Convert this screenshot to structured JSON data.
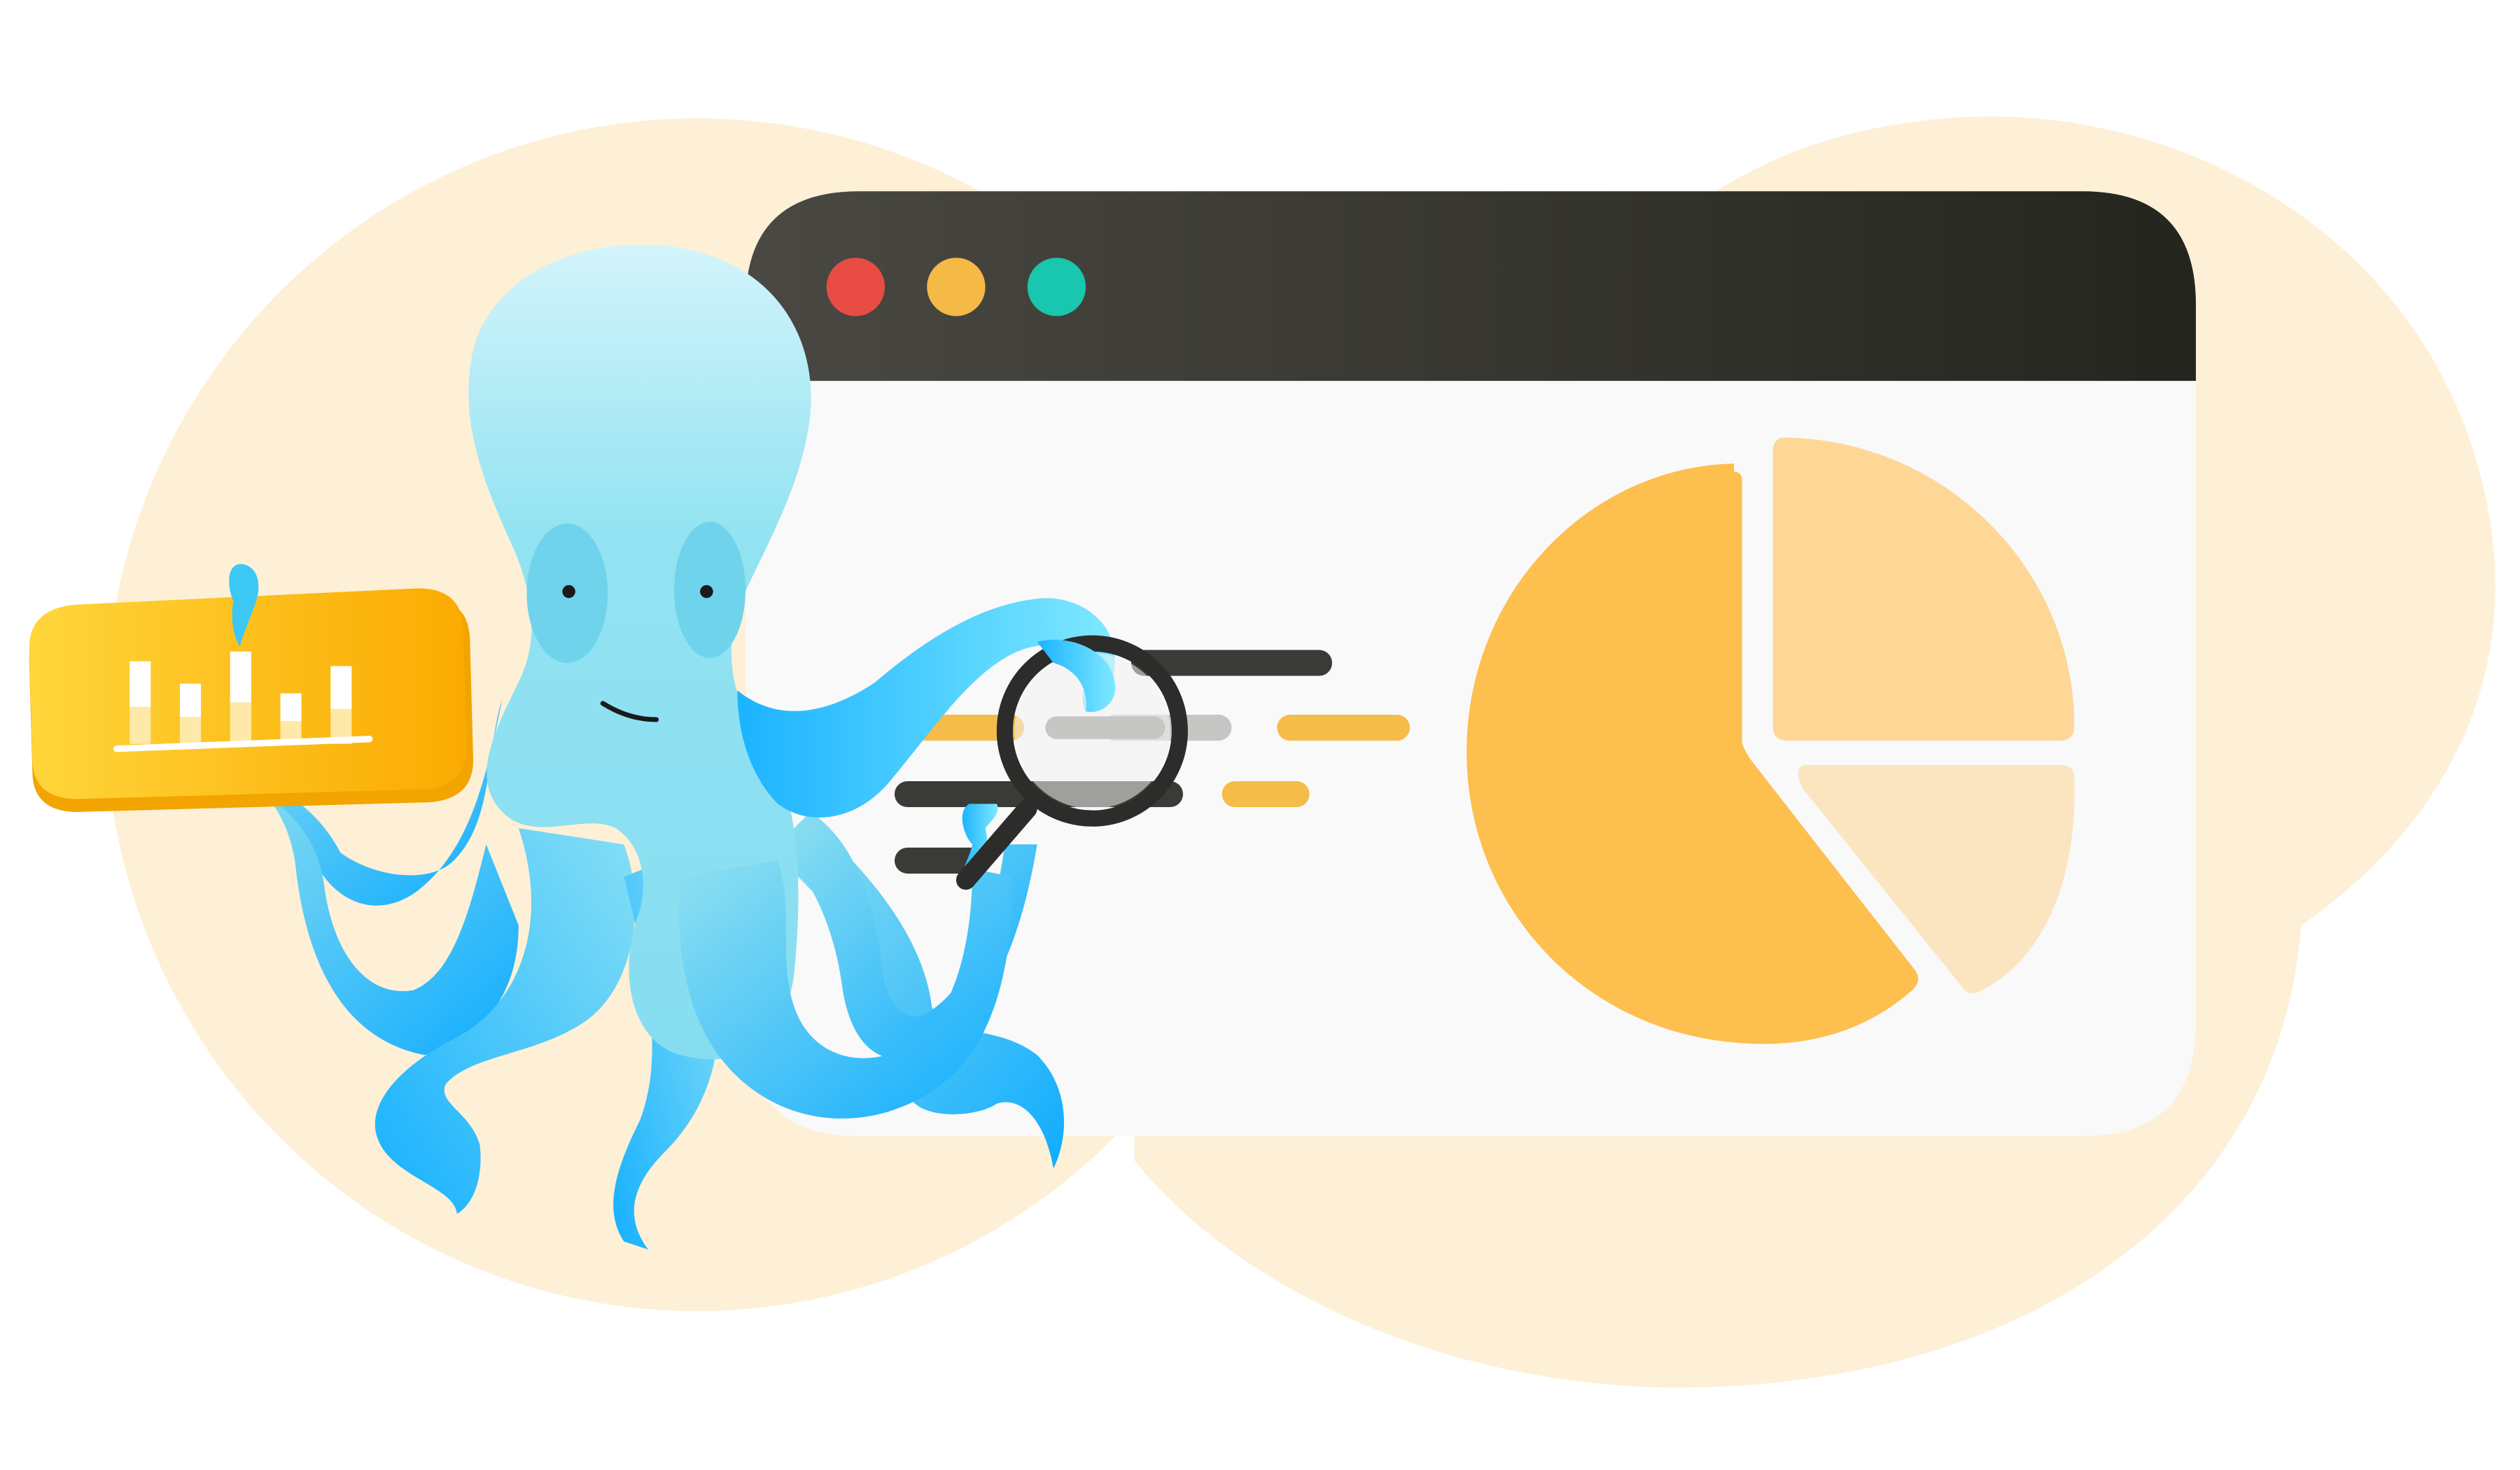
{
  "palette": {
    "background_blob": "#FDF0D6",
    "window_bar_dark": "#2A2A24",
    "window_bar_light": "#4A4842",
    "window_body": "#F9F9F9",
    "dot_red": "#E84C45",
    "dot_yellow": "#F5B946",
    "dot_teal": "#19C6AE",
    "line_dark": "#3A3A36",
    "line_gray": "#C6C6C4",
    "line_orange": "#F6BC4A",
    "line_peach": "#FCE6C3",
    "pie_main": "#FDBF4E",
    "pie_mid": "#FED797",
    "pie_light": "#FBE4C0",
    "octopus_light": "#C9F1FB",
    "octopus_mid": "#8ADFF0",
    "octopus_deep": "#12AEFF",
    "badge_yellow": "#FFD43A",
    "badge_orange": "#FBAA00",
    "magnifier": "#2C2C2A"
  },
  "window": {
    "controls": [
      "close-dot",
      "minimize-dot",
      "maximize-dot"
    ]
  },
  "icons": {
    "octopus": "octopus-mascot",
    "magnifier": "magnifying-glass-icon",
    "bar_badge": "bar-chart-badge-icon",
    "pie": "pie-chart-icon"
  },
  "pie_chart": {
    "slices": [
      {
        "name": "large",
        "share": 0.62
      },
      {
        "name": "medium",
        "share": 0.25
      },
      {
        "name": "small",
        "share": 0.13
      }
    ]
  },
  "badge_bars": {
    "values": [
      0.85,
      0.62,
      0.95,
      0.52,
      0.8
    ],
    "max": 1
  }
}
